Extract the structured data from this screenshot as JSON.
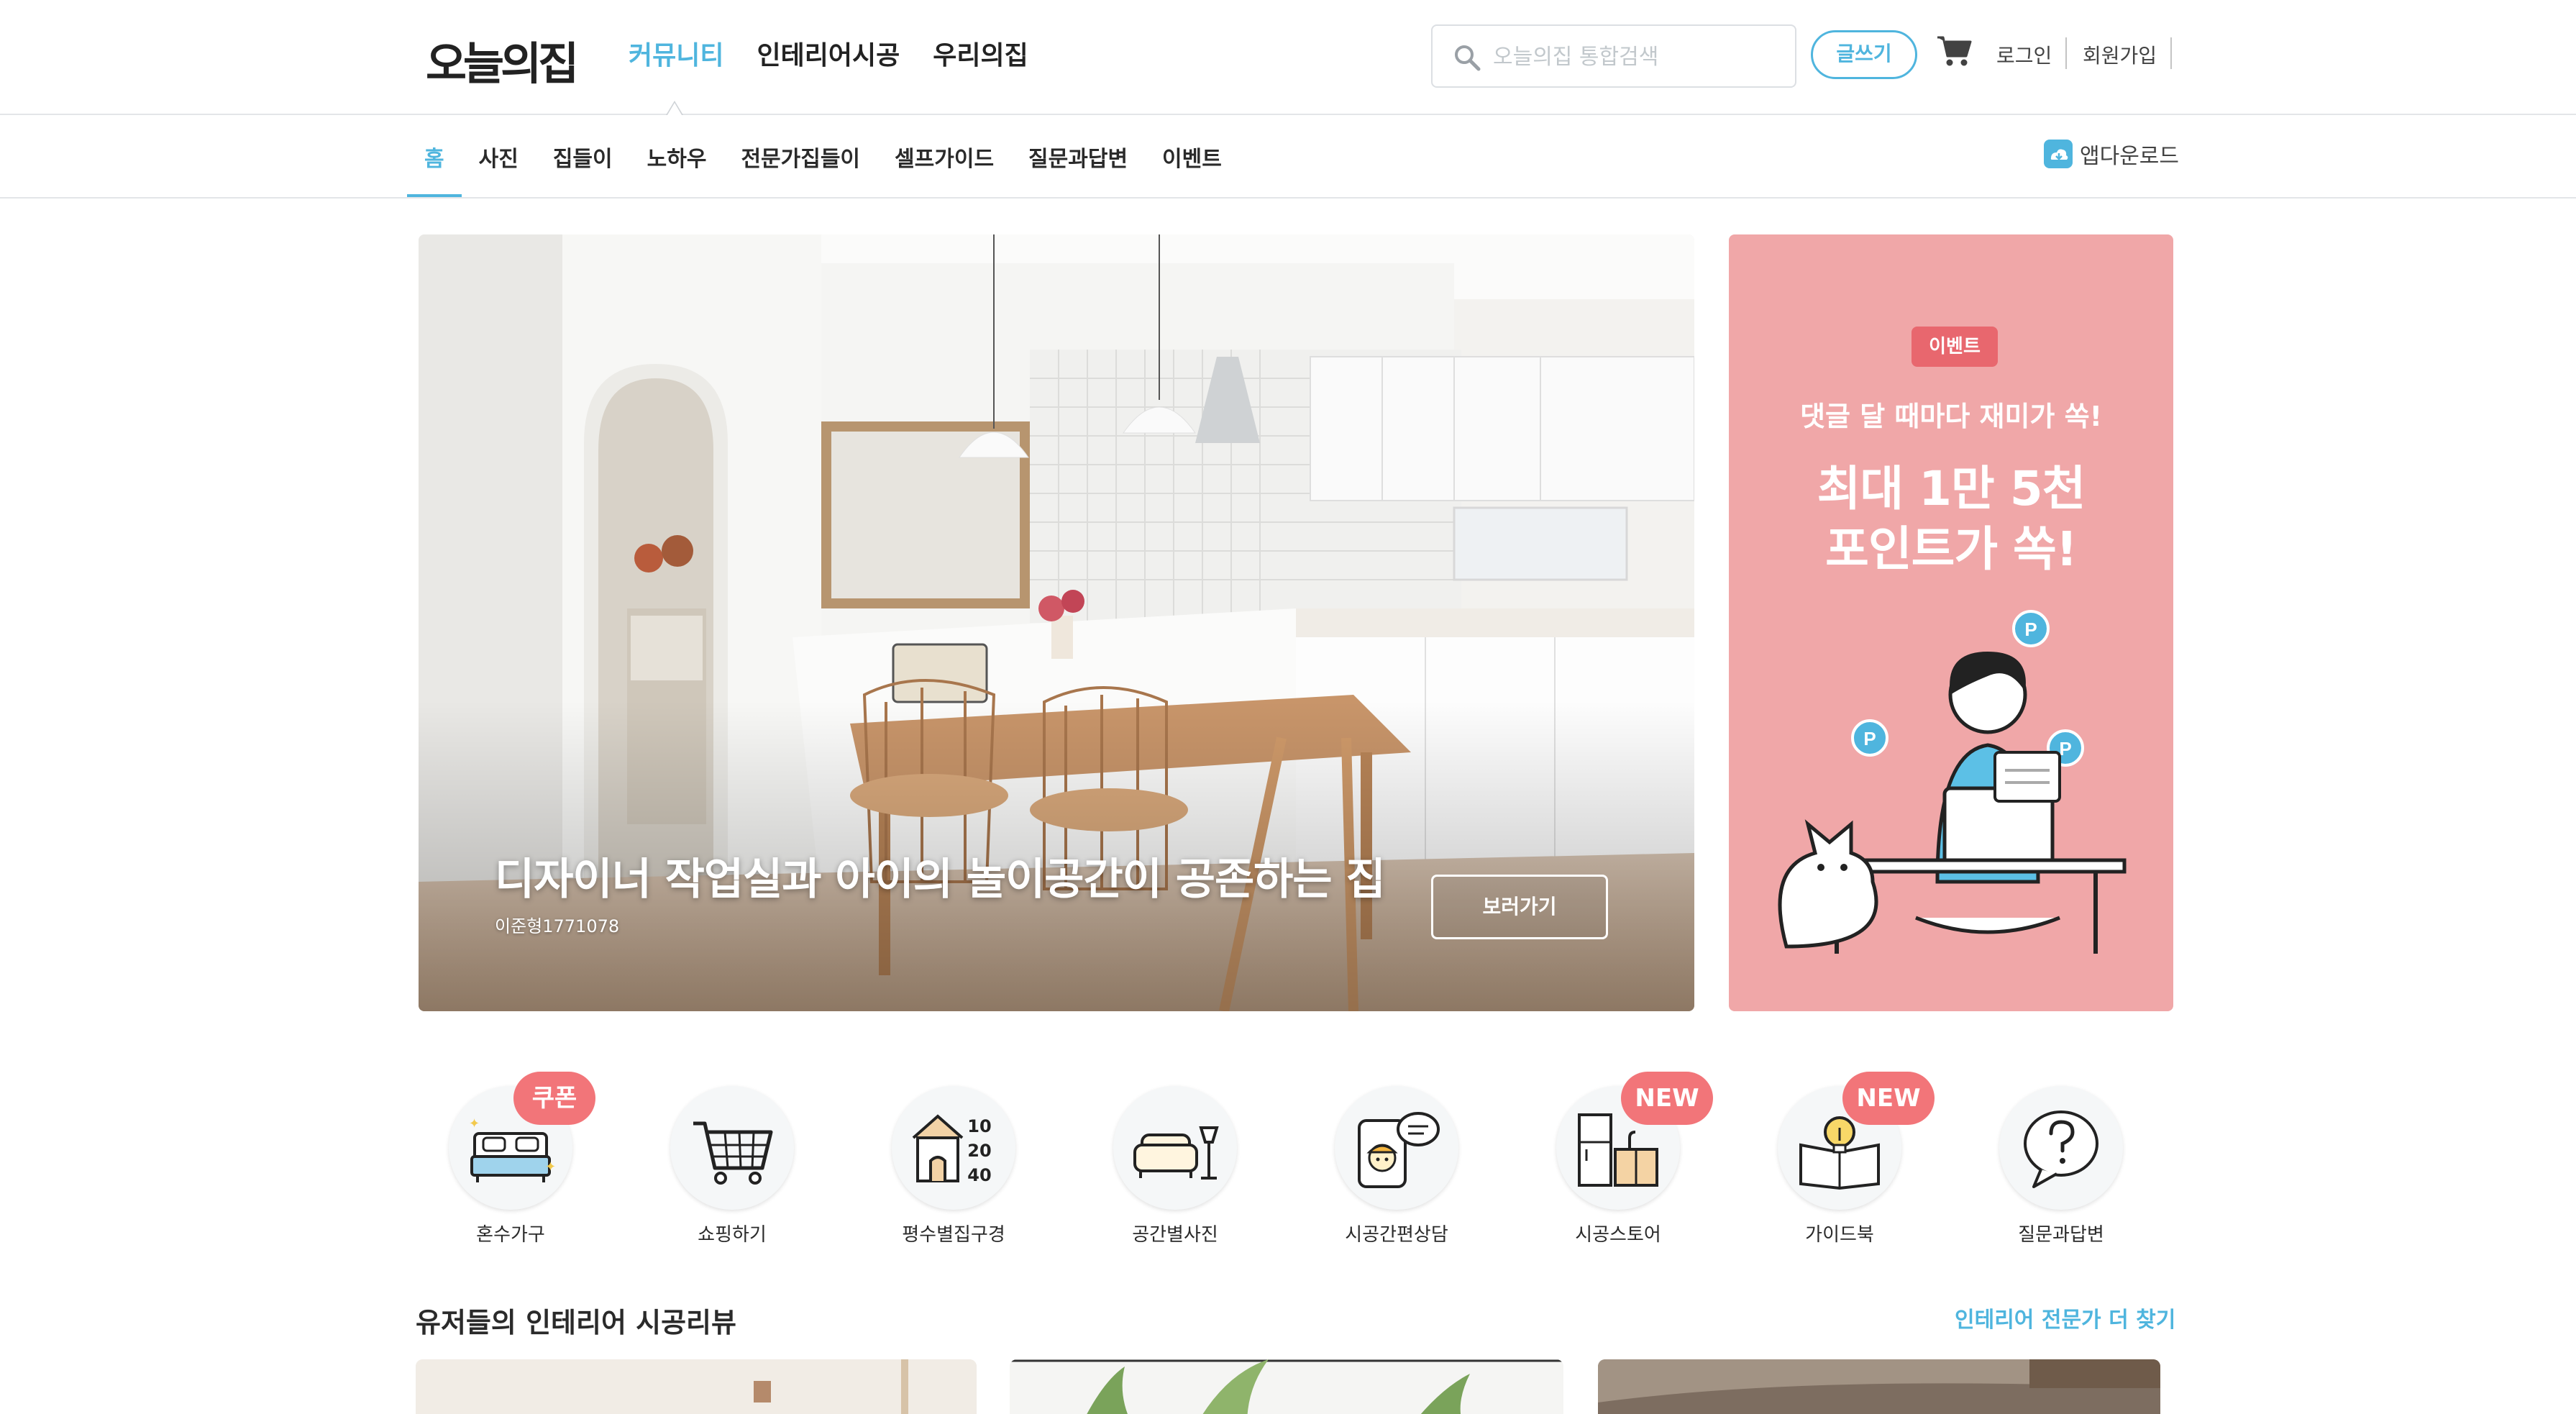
{
  "header": {
    "logo": "오늘의집",
    "nav": [
      "커뮤니티",
      "인테리어시공",
      "우리의집"
    ],
    "search_placeholder": "오늘의집 통합검색",
    "write_label": "글쓰기",
    "login_label": "로그인",
    "signup_label": "회원가입"
  },
  "subnav": {
    "items": [
      "홈",
      "사진",
      "집들이",
      "노하우",
      "전문가집들이",
      "셀프가이드",
      "질문과답변",
      "이벤트"
    ],
    "app_download": "앱다운로드"
  },
  "hero": {
    "title": "디자이너 작업실과 아이의 놀이공간이 공존하는 집",
    "author": "이준형1771078",
    "button": "보러가기"
  },
  "event_banner": {
    "badge": "이벤트",
    "subtitle": "댓글 달 때마다 재미가 쏙!",
    "headline_1": "최대 1만 5천",
    "headline_2": "포인트가 쏙!"
  },
  "categories": [
    {
      "label": "혼수가구",
      "tag": "쿠폰",
      "icon": "bed-icon"
    },
    {
      "label": "쇼핑하기",
      "tag": "",
      "icon": "cart-icon"
    },
    {
      "label": "평수별집구경",
      "tag": "",
      "icon": "house-size-icon",
      "numbers": [
        "10",
        "20",
        "40"
      ]
    },
    {
      "label": "공간별사진",
      "tag": "",
      "icon": "sofa-icon"
    },
    {
      "label": "시공간편상담",
      "tag": "",
      "icon": "consult-icon"
    },
    {
      "label": "시공스토어",
      "tag": "NEW",
      "icon": "cabinet-icon"
    },
    {
      "label": "가이드북",
      "tag": "NEW",
      "icon": "guidebook-icon"
    },
    {
      "label": "질문과답변",
      "tag": "",
      "icon": "question-icon"
    }
  ],
  "reviews": {
    "title": "유저들의 인테리어 시공리뷰",
    "more_link": "인테리어 전문가 더 찾기"
  },
  "colors": {
    "accent": "#4fb5de",
    "event_bg": "#f0a7a8",
    "tag": "#f27579"
  }
}
